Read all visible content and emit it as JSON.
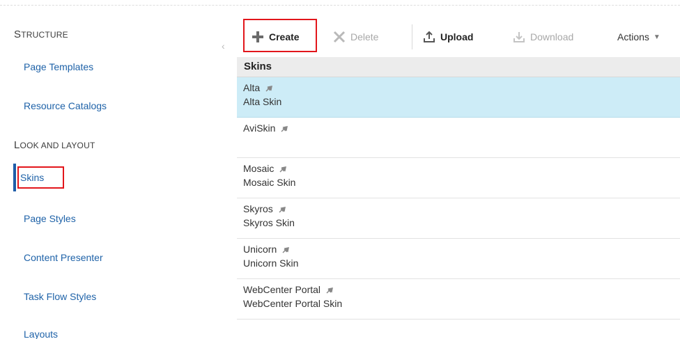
{
  "sidebar": {
    "sections": [
      {
        "title": "Structure"
      },
      {
        "title": "Look and Layout"
      }
    ],
    "items": [
      {
        "label": "Page Templates"
      },
      {
        "label": "Resource Catalogs"
      },
      {
        "label": "Skins"
      },
      {
        "label": "Page Styles"
      },
      {
        "label": "Content Presenter"
      },
      {
        "label": "Task Flow Styles"
      },
      {
        "label": "Layouts"
      }
    ],
    "collapse_glyph": "‹"
  },
  "toolbar": {
    "create_label": "Create",
    "delete_label": "Delete",
    "upload_label": "Upload",
    "download_label": "Download",
    "actions_label": "Actions"
  },
  "table": {
    "header": "Skins",
    "rows": [
      {
        "name": "Alta",
        "desc": "Alta Skin"
      },
      {
        "name": "AviSkin",
        "desc": ""
      },
      {
        "name": "Mosaic",
        "desc": "Mosaic Skin"
      },
      {
        "name": "Skyros",
        "desc": "Skyros Skin"
      },
      {
        "name": "Unicorn",
        "desc": "Unicorn Skin"
      },
      {
        "name": "WebCenter Portal",
        "desc": "WebCenter Portal Skin"
      }
    ]
  },
  "colors": {
    "link": "#1e62a8",
    "highlight_box": "#e2161b",
    "selected_row": "#cdecf7",
    "active_bar": "#1f5da8"
  }
}
